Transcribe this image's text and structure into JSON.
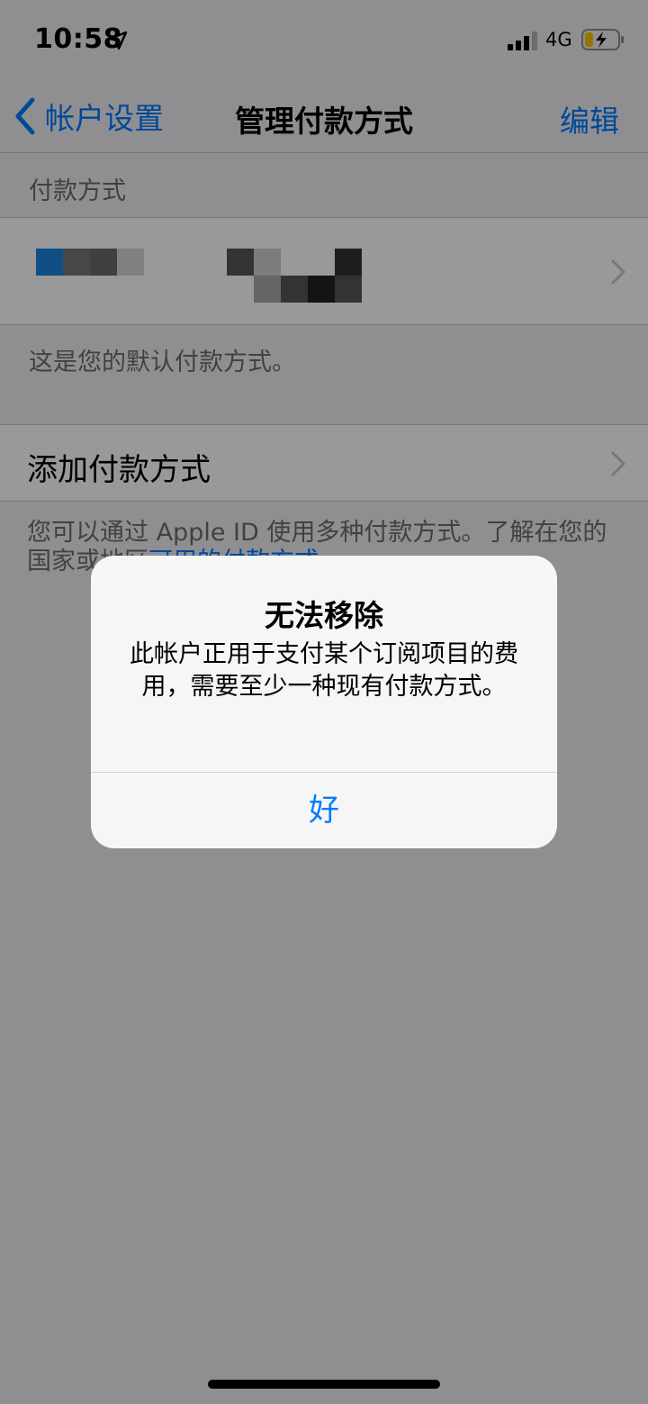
{
  "status_bar": {
    "time": "10:58",
    "network": "4G",
    "location_icon": "location-arrow-icon",
    "signal_icon": "cellular-signal-icon",
    "battery_icon": "battery-charging-icon"
  },
  "nav": {
    "back_label": "帐户设置",
    "title": "管理付款方式",
    "edit_label": "编辑",
    "back_icon": "chevron-left-icon"
  },
  "payment_section": {
    "header": "付款方式",
    "footer": "这是您的默认付款方式。"
  },
  "add_payment": {
    "label": "添加付款方式"
  },
  "info": {
    "text": "您可以通过 Apple ID 使用多种付款方式。了解在您的国家或地区",
    "link": "可用的付款方式"
  },
  "alert": {
    "title": "无法移除",
    "message": "此帐户正用于支付某个订阅项目的费用，需要至少一种现有付款方式。",
    "button": "好"
  },
  "colors": {
    "accent": "#007aff",
    "background": "#efeff4",
    "secondary_text": "#6d6d72"
  }
}
